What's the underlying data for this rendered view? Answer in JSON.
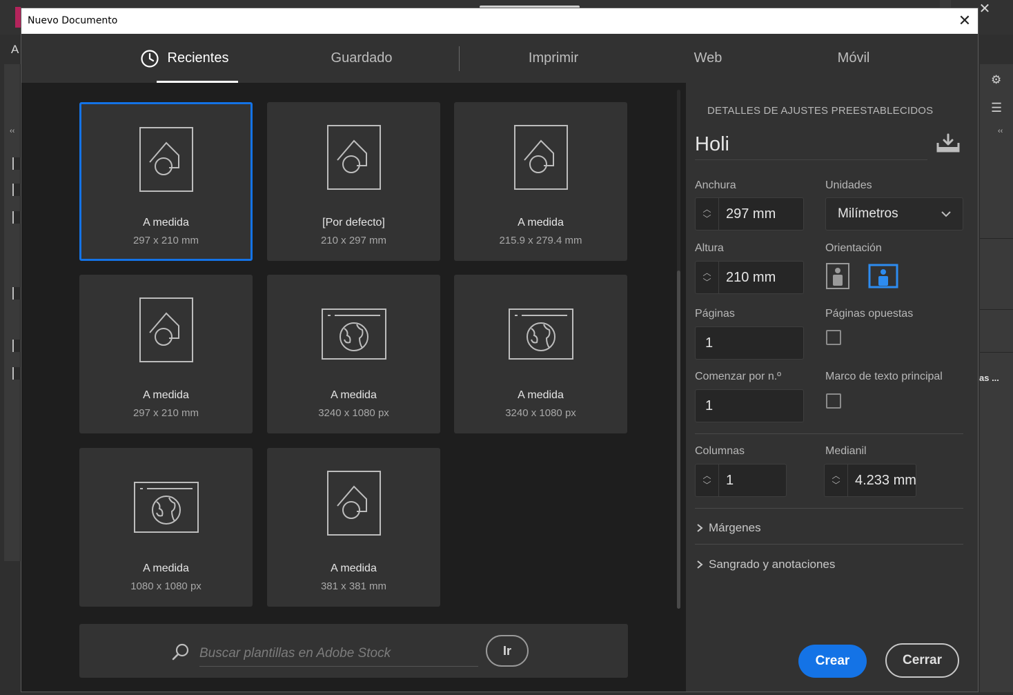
{
  "dialog": {
    "title": "Nuevo Documento",
    "close_glyph": "✕"
  },
  "tabs": [
    {
      "label": "Recientes",
      "active": true,
      "icon": "clock-icon"
    },
    {
      "label": "Guardado",
      "active": false
    },
    {
      "label": "Imprimir",
      "active": false
    },
    {
      "label": "Web",
      "active": false
    },
    {
      "label": "Móvil",
      "active": false
    }
  ],
  "presets": [
    {
      "name": "A medida",
      "size": "297 x 210 mm",
      "kind": "print",
      "selected": true
    },
    {
      "name": "[Por defecto]",
      "size": "210 x 297 mm",
      "kind": "print",
      "selected": false
    },
    {
      "name": "A medida",
      "size": "215.9 x 279.4 mm",
      "kind": "print",
      "selected": false
    },
    {
      "name": "A medida",
      "size": "297 x 210 mm",
      "kind": "print",
      "selected": false
    },
    {
      "name": "A medida",
      "size": "3240 x 1080 px",
      "kind": "web",
      "selected": false
    },
    {
      "name": "A medida",
      "size": "3240 x 1080 px",
      "kind": "web",
      "selected": false
    },
    {
      "name": "A medida",
      "size": "1080 x 1080 px",
      "kind": "web",
      "selected": false
    },
    {
      "name": "A medida",
      "size": "381 x 381 mm",
      "kind": "print",
      "selected": false
    }
  ],
  "search": {
    "placeholder": "Buscar plantillas en Adobe Stock",
    "go_label": "Ir"
  },
  "details": {
    "heading": "DETALLES DE AJUSTES PREESTABLECIDOS",
    "preset_name": "Holi",
    "width_label": "Anchura",
    "width_value": "297 mm",
    "units_label": "Unidades",
    "units_value": "Milímetros",
    "height_label": "Altura",
    "height_value": "210 mm",
    "orientation_label": "Orientación",
    "orientation_selected": "landscape",
    "pages_label": "Páginas",
    "pages_value": "1",
    "facing_label": "Páginas opuestas",
    "facing_checked": false,
    "start_label": "Comenzar por n.º",
    "start_value": "1",
    "primary_frame_label": "Marco de texto principal",
    "primary_frame_checked": false,
    "columns_label": "Columnas",
    "columns_value": "1",
    "gutter_label": "Medianil",
    "gutter_value": "4.233 mm",
    "margins_label": "Márgenes",
    "bleed_label": "Sangrado y anotaciones",
    "create_label": "Crear",
    "close_label": "Cerrar"
  },
  "background": {
    "menu_letter": "A",
    "right_panel_text": "as ..."
  },
  "colors": {
    "accent": "#1473e6",
    "dialog_bg": "#1e1e1e",
    "panel_bg": "#323232",
    "tile_bg": "#333333"
  }
}
